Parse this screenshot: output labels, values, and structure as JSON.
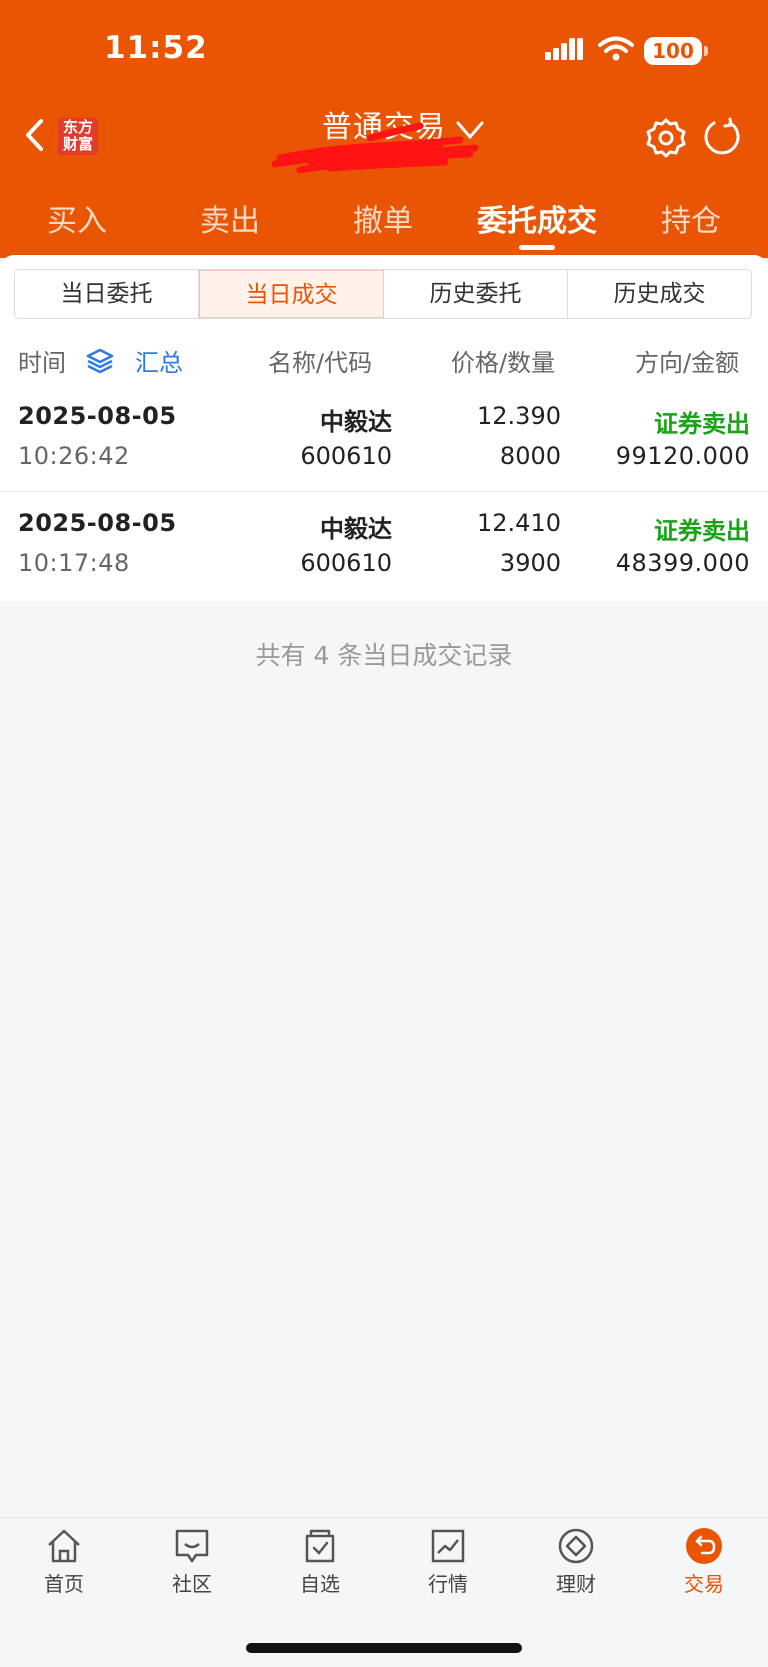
{
  "status": {
    "time": "11:52",
    "battery": "100"
  },
  "header": {
    "logo": "东方\n财富",
    "title": "普通交易"
  },
  "top_tabs": [
    "买入",
    "卖出",
    "撤单",
    "委托成交",
    "持仓"
  ],
  "segments": [
    "当日委托",
    "当日成交",
    "历史委托",
    "历史成交"
  ],
  "columns": {
    "time": "时间",
    "summary": "汇总",
    "name_code": "名称/代码",
    "price_qty": "价格/数量",
    "dir_amount": "方向/金额"
  },
  "rows": [
    {
      "date": "2025-08-05",
      "time": "10:26:42",
      "name": "中毅达",
      "code": "600610",
      "price": "12.390",
      "qty": "8000",
      "direction": "证券卖出",
      "amount": "99120.000"
    },
    {
      "date": "2025-08-05",
      "time": "10:17:48",
      "name": "中毅达",
      "code": "600610",
      "price": "12.410",
      "qty": "3900",
      "direction": "证券卖出",
      "amount": "48399.000"
    }
  ],
  "footer": "共有 4 条当日成交记录",
  "bottom_nav": [
    "首页",
    "社区",
    "自选",
    "行情",
    "理财",
    "交易"
  ],
  "colors": {
    "brand": "#ea5504",
    "sell": "#19a319",
    "summary": "#2f7ae5"
  }
}
